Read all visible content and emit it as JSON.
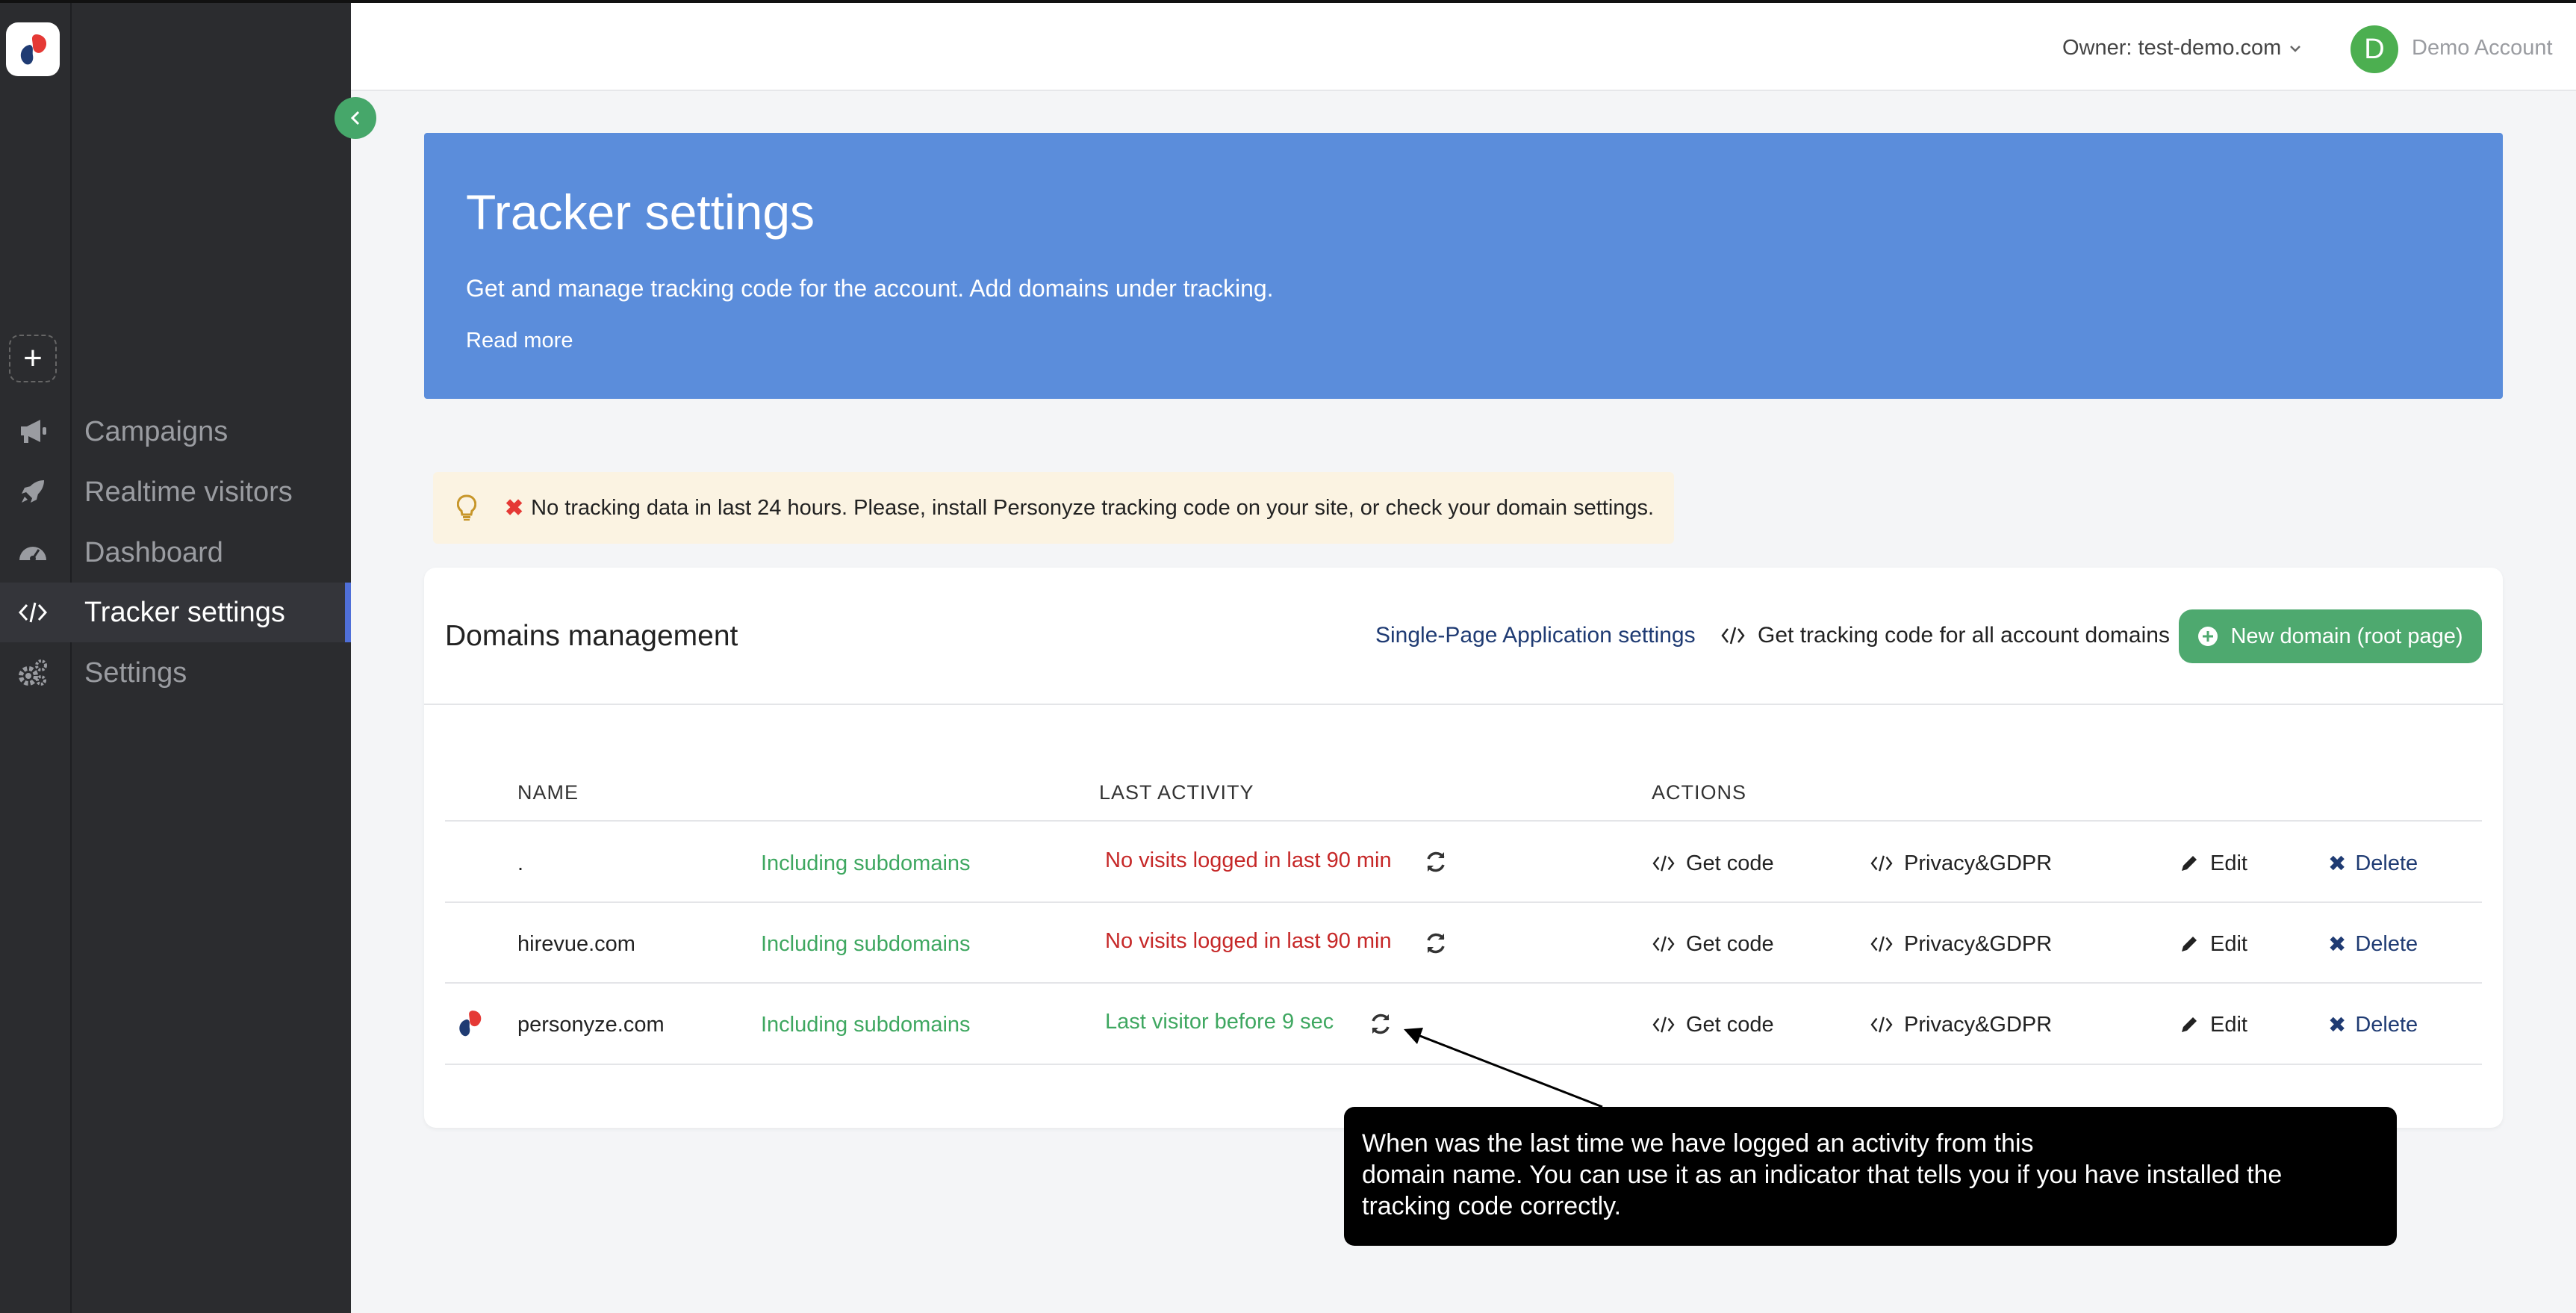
{
  "sidebar": {
    "items": [
      {
        "label": "Campaigns",
        "icon": "megaphone-icon"
      },
      {
        "label": "Realtime visitors",
        "icon": "rocket-icon"
      },
      {
        "label": "Dashboard",
        "icon": "dashboard-gauge-icon"
      },
      {
        "label": "Tracker settings",
        "icon": "code-icon",
        "active": true
      },
      {
        "label": "Settings",
        "icon": "gears-icon"
      }
    ]
  },
  "header": {
    "owner": "Owner: test-demo.com",
    "avatar_letter": "D",
    "account": "Demo Account"
  },
  "hero": {
    "title": "Tracker settings",
    "description": "Get and manage tracking code for the account. Add domains under tracking.",
    "read_more": "Read more"
  },
  "alert": {
    "text": "No tracking data in last 24 hours. Please, install Personyze tracking code on your site, or check your domain settings."
  },
  "domains": {
    "title": "Domains management",
    "spa_link": "Single-Page Application settings",
    "get_all_code": "Get tracking code for all account domains",
    "new_domain": "New domain (root page)",
    "columns": {
      "name": "NAME",
      "last_activity": "LAST ACTIVITY",
      "actions": "ACTIONS"
    },
    "rows": [
      {
        "name": ".",
        "subdomains": "Including subdomains",
        "activity": "No visits logged in last 90 min",
        "status": "bad"
      },
      {
        "name": "hirevue.com",
        "subdomains": "Including subdomains",
        "activity": "No visits logged in last 90 min",
        "status": "bad"
      },
      {
        "name": "personyze.com",
        "subdomains": "Including subdomains",
        "activity": "Last visitor before 9 sec",
        "status": "good",
        "favicon": "personyze-logo"
      }
    ],
    "actions": {
      "get_code": "Get code",
      "privacy": "Privacy&GDPR",
      "edit": "Edit",
      "delete": "Delete"
    }
  },
  "tooltip": {
    "line1": "When was the last time we have logged an activity from this",
    "line2": "domain name. You can use it as an indicator that tells you if you have installed the",
    "line3": "tracking code correctly."
  },
  "colors": {
    "hero_bg": "#5b8ddb",
    "sidebar_bg": "#2b2c2f",
    "accent_green": "#4ea96f",
    "status_bad": "#c62828",
    "status_good": "#3ea760",
    "active_indicator": "#4f6fd8"
  }
}
